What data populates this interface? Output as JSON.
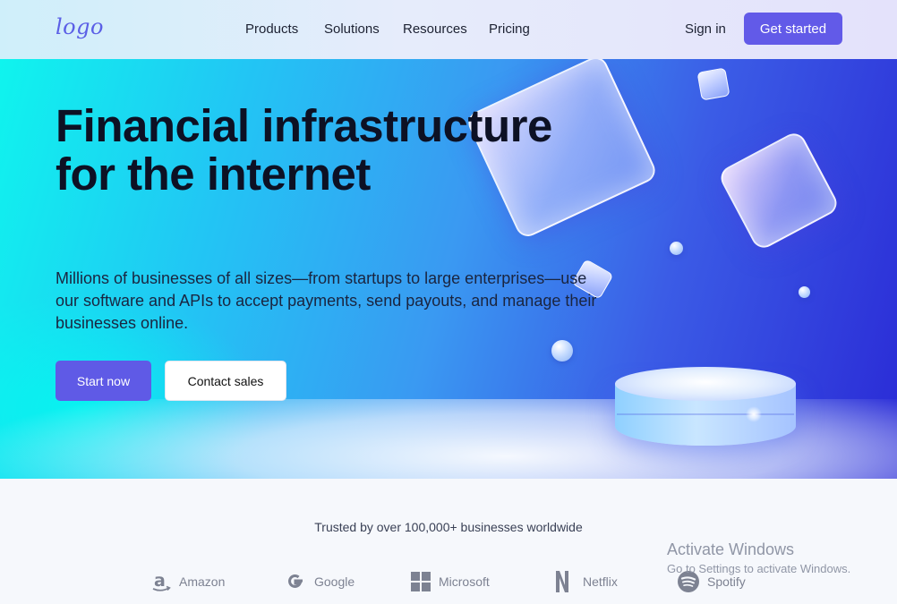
{
  "header": {
    "logo": "logo",
    "nav": [
      {
        "label": "Products"
      },
      {
        "label": "Solutions"
      },
      {
        "label": "Resources"
      },
      {
        "label": "Pricing"
      }
    ],
    "sign_in": "Sign in",
    "get_started": "Get started"
  },
  "hero": {
    "title": "Financial infrastructure for the internet",
    "subtitle": "Millions of businesses of all sizes—from startups to large enterprises—use our software and APIs to accept payments, send payouts, and manage their businesses online.",
    "primary_cta": "Start now",
    "secondary_cta": "Contact sales"
  },
  "trusted": {
    "text": "Trusted by over 100,000+ businesses worldwide",
    "brands": [
      {
        "name": "Amazon",
        "icon": "amazon-icon"
      },
      {
        "name": "Google",
        "icon": "google-icon"
      },
      {
        "name": "Microsoft",
        "icon": "microsoft-icon"
      },
      {
        "name": "Netflix",
        "icon": "netflix-icon"
      },
      {
        "name": "Spotify",
        "icon": "spotify-icon"
      }
    ]
  },
  "watermark": {
    "title": "Activate Windows",
    "subtitle": "Go to Settings to activate Windows."
  },
  "colors": {
    "accent": "#625ae8",
    "hero_start": "#0ff4ee",
    "hero_end": "#2a2ad6"
  }
}
